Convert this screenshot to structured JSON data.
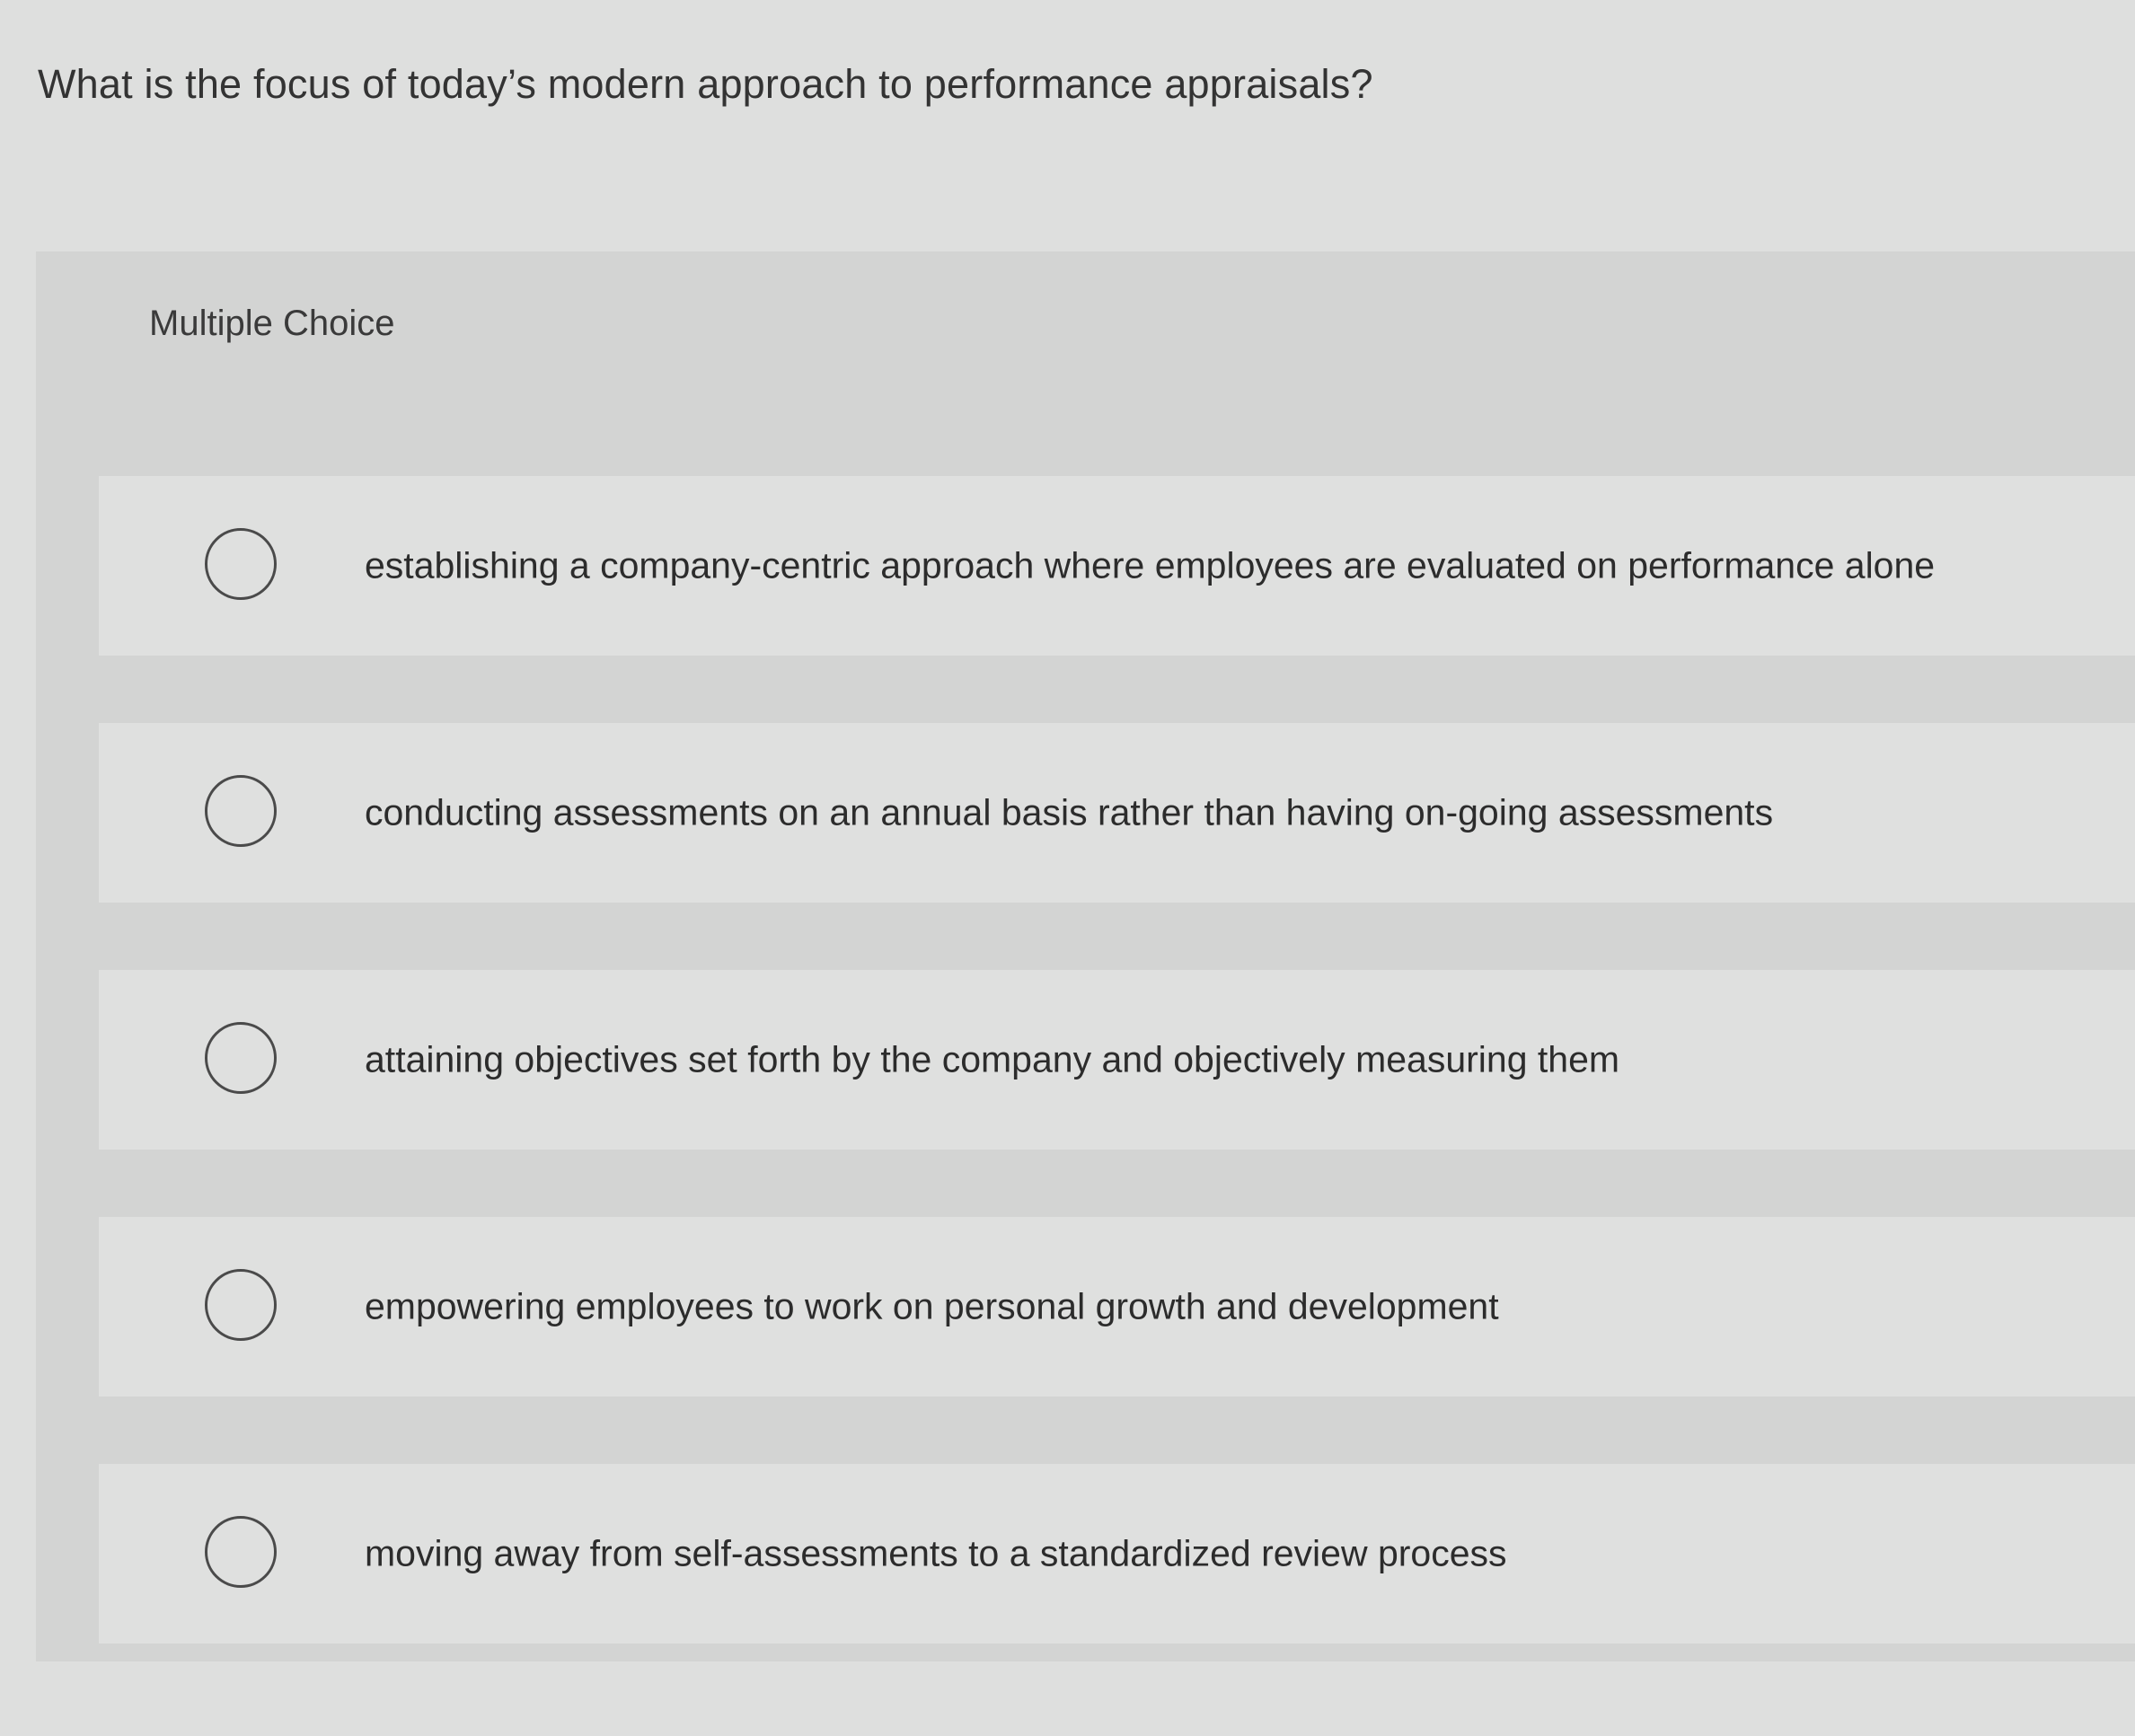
{
  "question": {
    "text": "What is the focus of today’s modern approach to performance appraisals?"
  },
  "panel": {
    "title": "Multiple Choice",
    "options": [
      {
        "label": "establishing a company-centric approach where employees are evaluated on performance alone"
      },
      {
        "label": "conducting assessments on an annual basis rather than having on-going assessments"
      },
      {
        "label": "attaining objectives set forth by the company and objectively measuring them"
      },
      {
        "label": "empowering employees to work on personal growth and development"
      },
      {
        "label": "moving away from self-assessments to a standardized review process"
      }
    ]
  }
}
